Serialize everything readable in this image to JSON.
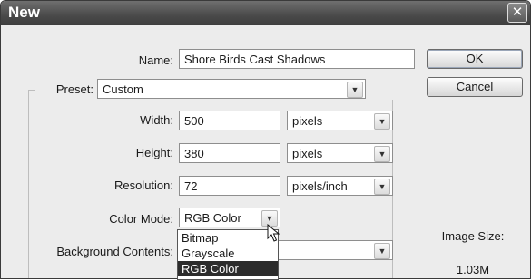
{
  "window": {
    "title": "New"
  },
  "form": {
    "name_label": "Name:",
    "name_value": "Shore Birds Cast Shadows",
    "preset_label": "Preset:",
    "preset_value": "Custom",
    "width_label": "Width:",
    "width_value": "500",
    "width_unit": "pixels",
    "height_label": "Height:",
    "height_value": "380",
    "height_unit": "pixels",
    "resolution_label": "Resolution:",
    "resolution_value": "72",
    "resolution_unit": "pixels/inch",
    "color_mode_label": "Color Mode:",
    "color_mode_value": "RGB Color",
    "background_label": "Background Contents:"
  },
  "color_mode_options": [
    "Bitmap",
    "Grayscale",
    "RGB Color"
  ],
  "buttons": {
    "ok": "OK",
    "cancel": "Cancel"
  },
  "info": {
    "image_size_label": "Image Size:",
    "image_size_value": "1.03M"
  },
  "icons": {
    "close": "close-icon",
    "dropdown": "chevron-down-icon",
    "cursor": "mouse-pointer-icon"
  },
  "colors": {
    "titlebar": "#4a4a4a",
    "selection": "#2c2c2c",
    "dialog_bg": "#ececec"
  }
}
